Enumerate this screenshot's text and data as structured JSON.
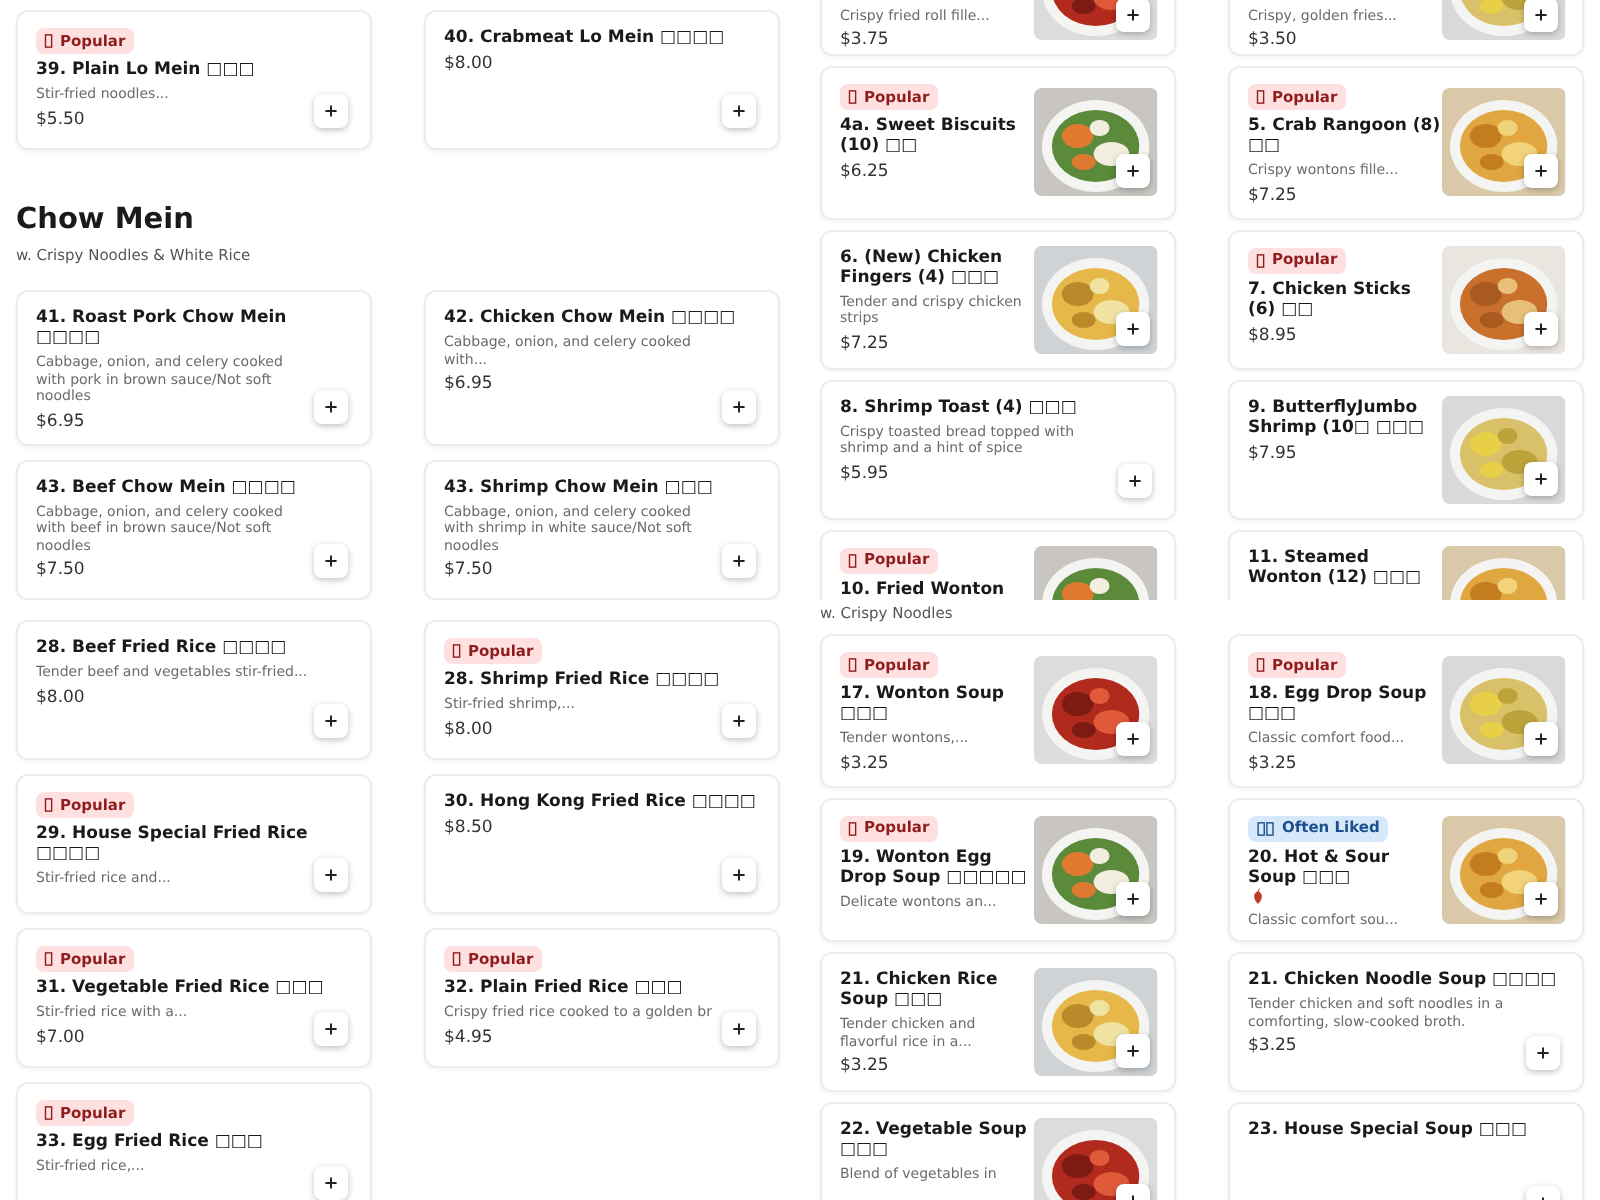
{
  "panels": [
    {
      "blocks": [
        {
          "kind": "cards",
          "items": [
            {
              "badge": {
                "kind": "popular",
                "label": "Popular"
              },
              "title": "39. Plain Lo Mein □□□",
              "desc": "Stir-fried noodles...",
              "price": "$5.50"
            },
            {
              "title": "40. Crabmeat Lo Mein □□□□",
              "price": "$8.00"
            }
          ]
        },
        {
          "kind": "heading",
          "title": "Chow Mein",
          "subtitle": "w. Crispy Noodles & White Rice"
        },
        {
          "kind": "cards",
          "items": [
            {
              "title": "41. Roast Pork Chow Mein □□□□",
              "desc": "Cabbage, onion, and celery cooked with pork in brown sauce/Not soft noodles",
              "price": "$6.95"
            },
            {
              "title": "42. Chicken Chow Mein □□□□",
              "desc": "Cabbage, onion, and celery cooked with...",
              "price": "$6.95"
            },
            {
              "title": "43. Beef Chow Mein □□□□",
              "desc": "Cabbage, onion, and celery cooked with beef in brown sauce/Not soft noodles",
              "price": "$7.50"
            },
            {
              "title": "43. Shrimp Chow Mein □□□",
              "desc": "Cabbage, onion, and celery cooked with shrimp in white sauce/Not soft noodles",
              "price": "$7.50"
            }
          ]
        }
      ]
    },
    {
      "blocks": [
        {
          "kind": "cards",
          "items": [
            {
              "desc": "Crispy fried roll fille...",
              "price": "$3.75"
            },
            {
              "desc": "Crispy, golden fries...",
              "price": "$3.50"
            },
            {
              "badge": {
                "kind": "popular",
                "label": "Popular"
              },
              "title": "4a. Sweet Biscuits (10) □□",
              "price": "$6.25"
            },
            {
              "badge": {
                "kind": "popular",
                "label": "Popular"
              },
              "title": "5. Crab Rangoon (8) □□",
              "desc": "Crispy wontons fille...",
              "price": "$7.25"
            },
            {
              "title": "6. (New) Chicken Fingers (4) □□□",
              "desc": "Tender and crispy chicken strips",
              "price": "$7.25"
            },
            {
              "badge": {
                "kind": "popular",
                "label": "Popular"
              },
              "title": "7. Chicken Sticks (6) □□",
              "price": "$8.95"
            },
            {
              "title": "8. Shrimp Toast (4) □□□",
              "desc": "Crispy toasted bread topped with shrimp and a hint of spice",
              "price": "$5.95"
            },
            {
              "title": "9. ButterflyJumbo Shrimp (10□ □□□",
              "price": "$7.95"
            },
            {
              "badge": {
                "kind": "popular",
                "label": "Popular"
              },
              "title": "10. Fried Wonton"
            },
            {
              "title": "11. Steamed Wonton (12) □□□"
            }
          ]
        }
      ]
    },
    {
      "blocks": [
        {
          "kind": "cards",
          "items": [
            {
              "title": "28. Beef Fried Rice □□□□",
              "desc": "Tender beef and vegetables stir-fried...",
              "price": "$8.00"
            },
            {
              "badge": {
                "kind": "popular",
                "label": "Popular"
              },
              "title": "28. Shrimp Fried Rice □□□□",
              "desc": "Stir-fried shrimp,...",
              "price": "$8.00"
            },
            {
              "badge": {
                "kind": "popular",
                "label": "Popular"
              },
              "title": "29. House Special Fried Rice □□□□",
              "desc": "Stir-fried rice and..."
            },
            {
              "title": "30. Hong Kong Fried Rice □□□□",
              "price": "$8.50"
            },
            {
              "badge": {
                "kind": "popular",
                "label": "Popular"
              },
              "title": "31. Vegetable Fried Rice □□□",
              "desc": "Stir-fried rice with a...",
              "price": "$7.00"
            },
            {
              "badge": {
                "kind": "popular",
                "label": "Popular"
              },
              "title": "32. Plain Fried Rice □□□",
              "desc": "Crispy fried rice cooked to a golden br",
              "price": "$4.95"
            },
            {
              "badge": {
                "kind": "popular",
                "label": "Popular"
              },
              "title": "33. Egg Fried Rice □□□",
              "desc": "Stir-fried rice,..."
            }
          ]
        }
      ]
    },
    {
      "blocks": [
        {
          "kind": "subtitle",
          "text": "w. Crispy Noodles"
        },
        {
          "kind": "cards",
          "items": [
            {
              "badge": {
                "kind": "popular",
                "label": "Popular"
              },
              "title": "17. Wonton Soup □□□",
              "desc": "Tender wontons,...",
              "price": "$3.25"
            },
            {
              "badge": {
                "kind": "popular",
                "label": "Popular"
              },
              "title": "18. Egg Drop Soup □□□",
              "desc": "Classic comfort food...",
              "price": "$3.25"
            },
            {
              "badge": {
                "kind": "popular",
                "label": "Popular"
              },
              "title": "19. Wonton Egg Drop Soup □□□□□",
              "desc": "Delicate wontons an..."
            },
            {
              "badge": {
                "kind": "often_liked",
                "label": "Often Liked"
              },
              "title": "20. Hot & Sour Soup □□□",
              "spicy": true,
              "desc": "Classic comfort sou..."
            },
            {
              "title": "21. Chicken Rice Soup □□□",
              "desc": "Tender chicken and flavorful rice in a...",
              "price": "$3.25"
            },
            {
              "title": "21. Chicken Noodle Soup □□□□",
              "desc": "Tender chicken and soft noodles in a comforting, slow-cooked broth.",
              "price": "$3.25"
            },
            {
              "title": "22. Vegetable Soup □□□",
              "desc": "Blend of vegetables in"
            },
            {
              "title": "23. House Special Soup □□□"
            }
          ]
        }
      ]
    }
  ]
}
